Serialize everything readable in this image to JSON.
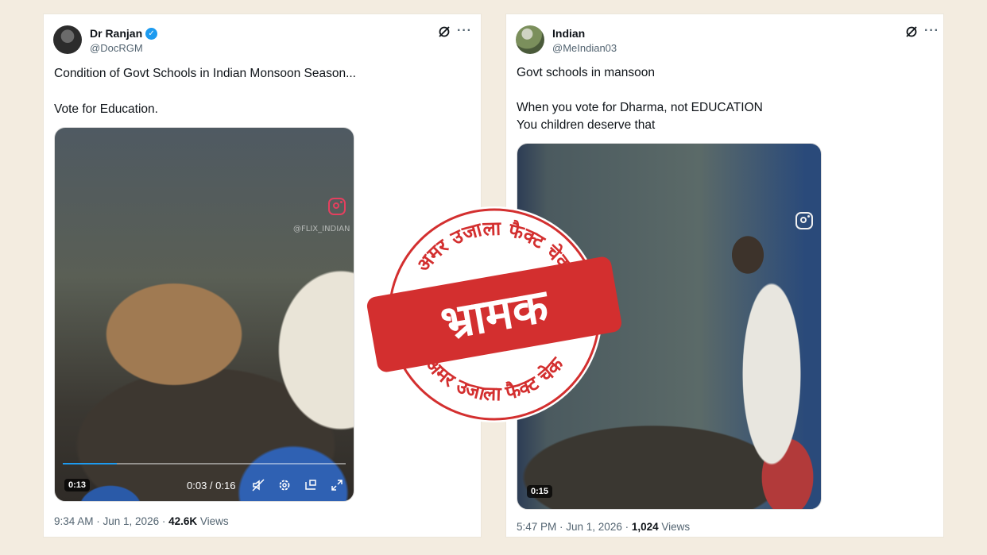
{
  "tweets": [
    {
      "name": "Dr Ranjan",
      "handle": "@DocRGM",
      "verified": true,
      "text_line1": "Condition of Govt Schools in Indian Monsoon Season...",
      "text_line2": "Vote for Education.",
      "video_watermark": "@FLIX_INDIAN",
      "video_badge": "0:13",
      "video_time": "0:03 / 0:16",
      "video_progress": 0.19,
      "timestamp": "9:34 AM · Jun 1, 2026 · ",
      "views_count": "42.6K",
      "views_label": " Views"
    },
    {
      "name": "Indian",
      "handle": "@MeIndian03",
      "verified": false,
      "text_line1": "Govt schools in mansoon",
      "text_line2": "When you vote for Dharma, not EDUCATION",
      "text_line3": "You children deserve that",
      "video_badge": "0:15",
      "timestamp": "5:47 PM · Jun 1, 2026 · ",
      "views_count": "1,024",
      "views_label": " Views"
    }
  ],
  "stamp": {
    "top_text": "अमर उजाला फैक्ट चेक",
    "main_text": "भ्रामक",
    "bottom_text": "अमर उजाला फैक्ट चेक",
    "color": "#d32f2f"
  },
  "colors": {
    "background": "#f3ece0",
    "verified_blue": "#1d9bf0",
    "instagram_pink": "#e4405f"
  },
  "icons": [
    "verified-badge-icon",
    "grok-icon",
    "more-icon",
    "instagram-icon",
    "mute-icon",
    "settings-icon",
    "pip-icon",
    "fullscreen-icon"
  ]
}
